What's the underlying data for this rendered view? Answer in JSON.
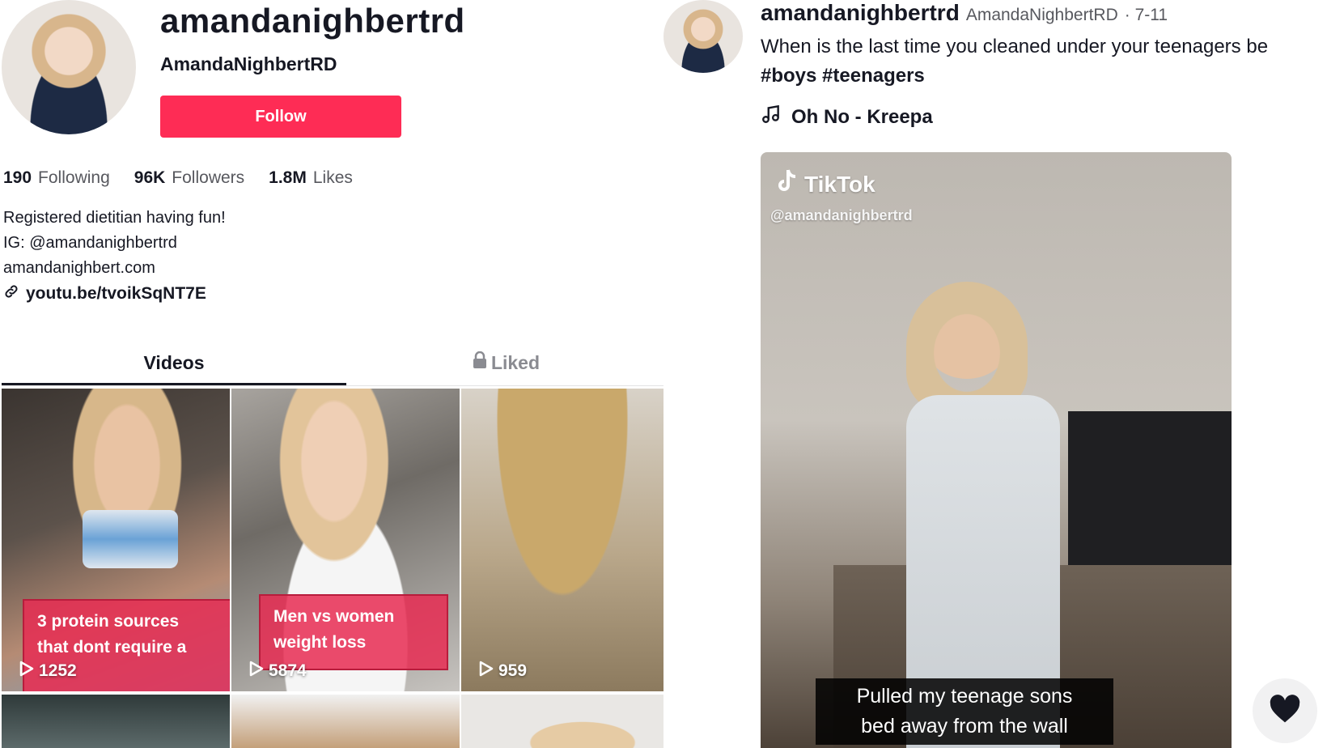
{
  "profile": {
    "username": "amandanighbertrd",
    "nickname": "AmandaNighbertRD",
    "follow_label": "Follow",
    "stats": [
      {
        "value": "190",
        "label": "Following"
      },
      {
        "value": "96K",
        "label": "Followers"
      },
      {
        "value": "1.8M",
        "label": "Likes"
      }
    ],
    "bio_lines": [
      "Registered dietitian having fun!",
      "IG: @amandanighbertrd",
      "amandanighbert.com"
    ],
    "link": "youtu.be/tvoikSqNT7E"
  },
  "tabs": {
    "videos": "Videos",
    "liked": "Liked"
  },
  "videos": [
    {
      "caption_lines": [
        "3 protein sources",
        "that dont require a"
      ],
      "views": "1252"
    },
    {
      "caption_lines": [
        "Men vs women",
        "weight loss"
      ],
      "views": "5874"
    },
    {
      "caption_lines": [],
      "views": "959"
    }
  ],
  "post": {
    "username": "amandanighbertrd",
    "nickname": "AmandaNighbertRD",
    "date": "· 7-11",
    "description": "When is the last time you cleaned under your teenagers be",
    "tags": "#boys #teenagers",
    "music": "Oh No - Kreepa",
    "watermark_brand": "TikTok",
    "watermark_handle": "@amandanighbertrd",
    "subtitle_lines": [
      "Pulled my teenage sons",
      "bed away from the wall"
    ]
  },
  "colors": {
    "accent": "#fe2c55",
    "text": "#161823",
    "muted": "#57585e"
  },
  "icons": [
    "link-icon",
    "lock-icon",
    "play-icon",
    "music-note-icon",
    "tiktok-logo-icon",
    "heart-icon"
  ]
}
